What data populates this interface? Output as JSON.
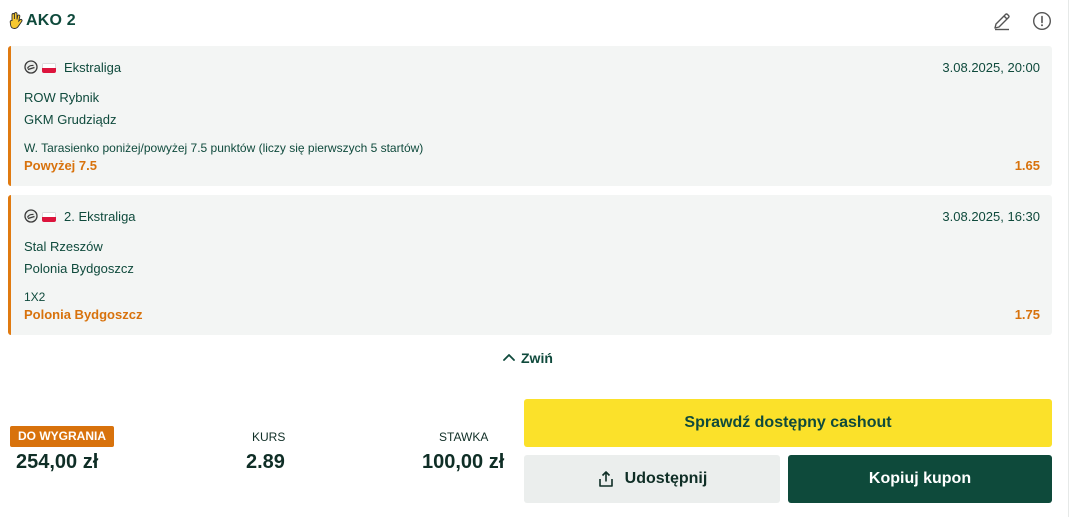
{
  "header": {
    "title": "AKO 2",
    "icons": {
      "hand": "hand-icon",
      "edit": "pencil-icon",
      "info": "info-icon"
    }
  },
  "bets": [
    {
      "league": "Ekstraliga",
      "date": "3.08.2025, 20:00",
      "team1": "ROW Rybnik",
      "team2": "GKM Grudziądz",
      "market": "W. Tarasienko poniżej/powyżej 7.5 punktów (liczy się pierwszych 5 startów)",
      "pick": "Powyżej 7.5",
      "odd": "1.65"
    },
    {
      "league": "2. Ekstraliga",
      "date": "3.08.2025, 16:30",
      "team1": "Stal Rzeszów",
      "team2": "Polonia Bydgoszcz",
      "market": "1X2",
      "pick": "Polonia Bydgoszcz",
      "odd": "1.75"
    }
  ],
  "collapse_label": "Zwiń",
  "summary": {
    "win_label": "DO WYGRANIA",
    "win_value": "254,00 zł",
    "odds_label": "KURS",
    "odds_value": "2.89",
    "stake_label": "STAWKA",
    "stake_value": "100,00 zł"
  },
  "buttons": {
    "cashout": "Sprawdź dostępny cashout",
    "share": "Udostępnij",
    "copy": "Kopiuj kupon"
  },
  "colors": {
    "brand_green": "#0e4a3b",
    "accent_orange": "#d8720c",
    "cashout_yellow": "#fbe12a",
    "card_bg": "#f3f5f4"
  }
}
